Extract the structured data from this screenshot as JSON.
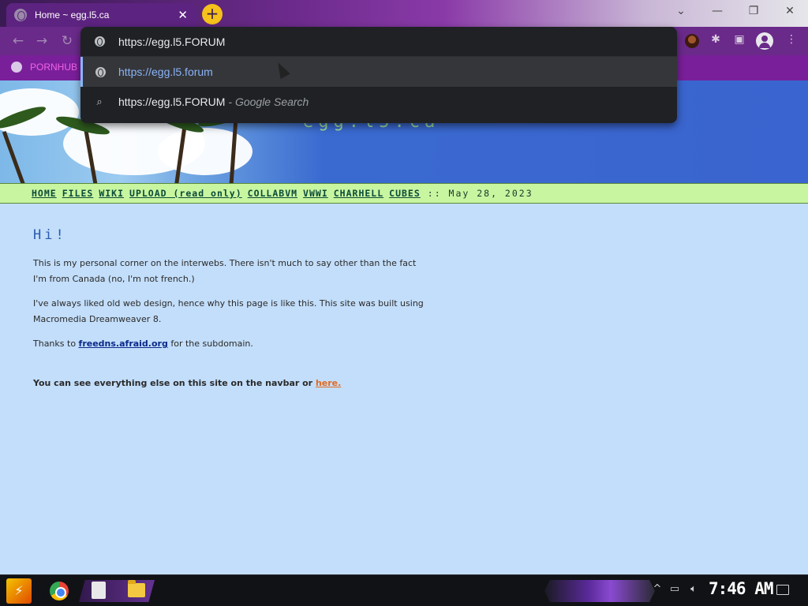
{
  "browser": {
    "tab": {
      "title": "Home ~ egg.l5.ca",
      "close": "✕"
    },
    "newtab": "+",
    "window": {
      "menu": "⌄",
      "minimize": "—",
      "restore": "❐",
      "close": "✕"
    },
    "nav": {
      "back": "←",
      "forward": "→",
      "reload": "↻"
    },
    "bookmarks": [
      {
        "label": "PORNHUB"
      }
    ]
  },
  "omnibox": {
    "input_value": "https://egg.l5.FORUM",
    "suggestions": [
      {
        "text": "https://egg.l5.forum",
        "icon": "globe-icon"
      },
      {
        "text": "https://egg.l5.FORUM",
        "sub": "- Google Search",
        "icon": "search-icon"
      }
    ]
  },
  "page": {
    "site_title": "egg.l5.ca",
    "navbar": {
      "links": [
        "HOME",
        "FILES",
        "WIKI",
        "UPLOAD (read only)",
        "COLLABVM",
        "VWWI",
        "CHARHELL",
        "CUBES"
      ],
      "date": ":: May 28, 2023"
    },
    "heading": "Hi!",
    "para1": "This is my personal corner on the interwebs. There isn't much to say other than the fact I'm from Canada (no, I'm not french.)",
    "para2": "I've always liked old web design, hence why this page is like this. This site was built using Macromedia Dreamweaver 8.",
    "para3_pre": "Thanks to ",
    "para3_link": "freedns.afraid.org",
    "para3_post": " for the subdomain.",
    "para4_pre": "You can see everything else on this site on the navbar or ",
    "para4_link": "here."
  },
  "taskbar": {
    "clock": "7:46 AM",
    "tray_chevron": "^"
  },
  "colors": {
    "accent": "#6a2a8a",
    "page_bg": "#c3defa",
    "navbar_bg": "#c8f5a0",
    "link_orange": "#e36a20"
  }
}
